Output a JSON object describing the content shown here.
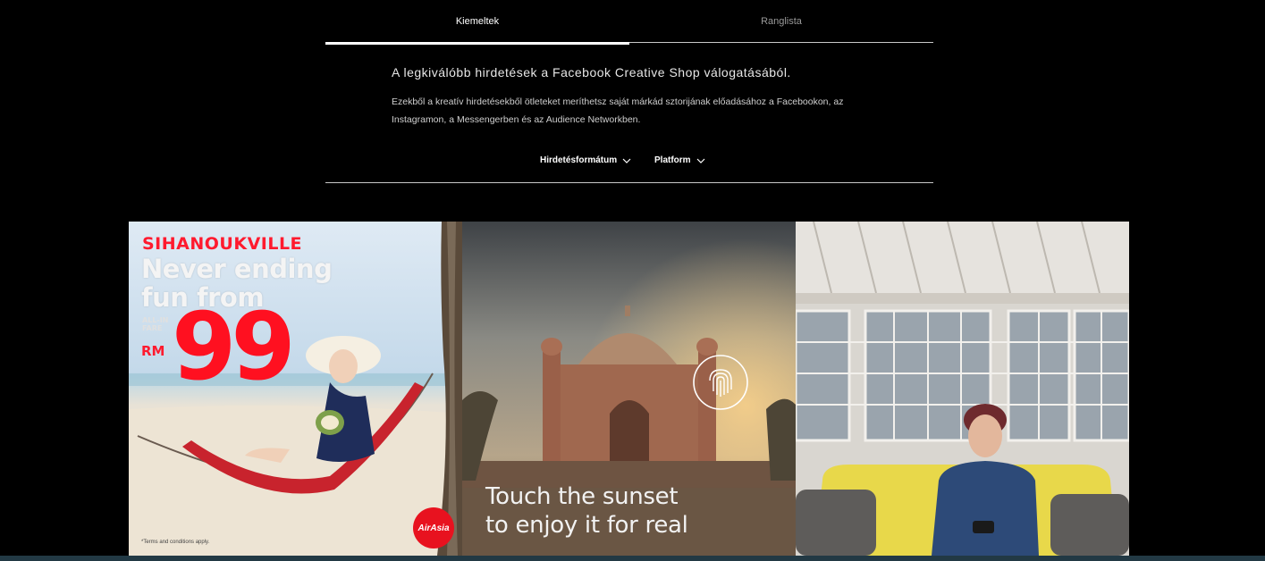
{
  "tabs": [
    {
      "label": "Kiemeltek",
      "active": true
    },
    {
      "label": "Ranglista",
      "active": false
    }
  ],
  "headline": "A legkiválóbb hirdetések a Facebook Creative Shop válogatásából.",
  "description": "Ezekből a kreatív hirdetésekből ötleteket meríthetsz saját márkád sztorijának előadásához a Facebookon, az Instagramon, a Messengerben és az Audience Networkben.",
  "filters": [
    {
      "label": "Hirdetésformátum",
      "icon": "chevron-down-icon"
    },
    {
      "label": "Platform",
      "icon": "chevron-down-icon"
    }
  ],
  "cards": [
    {
      "title": "SIHANOUKVILLE",
      "line1": "Never ending",
      "line2": "fun from",
      "fare_label": "ALL-IN FARE",
      "currency": "RM",
      "price": "99",
      "terms": "*Terms and conditions apply.",
      "logo": "AirAsia"
    },
    {
      "caption_line1": "Touch the sunset",
      "caption_line2": "to enjoy it for real",
      "icon": "fingerprint-icon"
    },
    {
      "scene": "person-on-yellow-sofa"
    }
  ],
  "colors": {
    "background": "#000000",
    "accent_red": "#ff1a2e",
    "divider": "#c8c8c8"
  }
}
